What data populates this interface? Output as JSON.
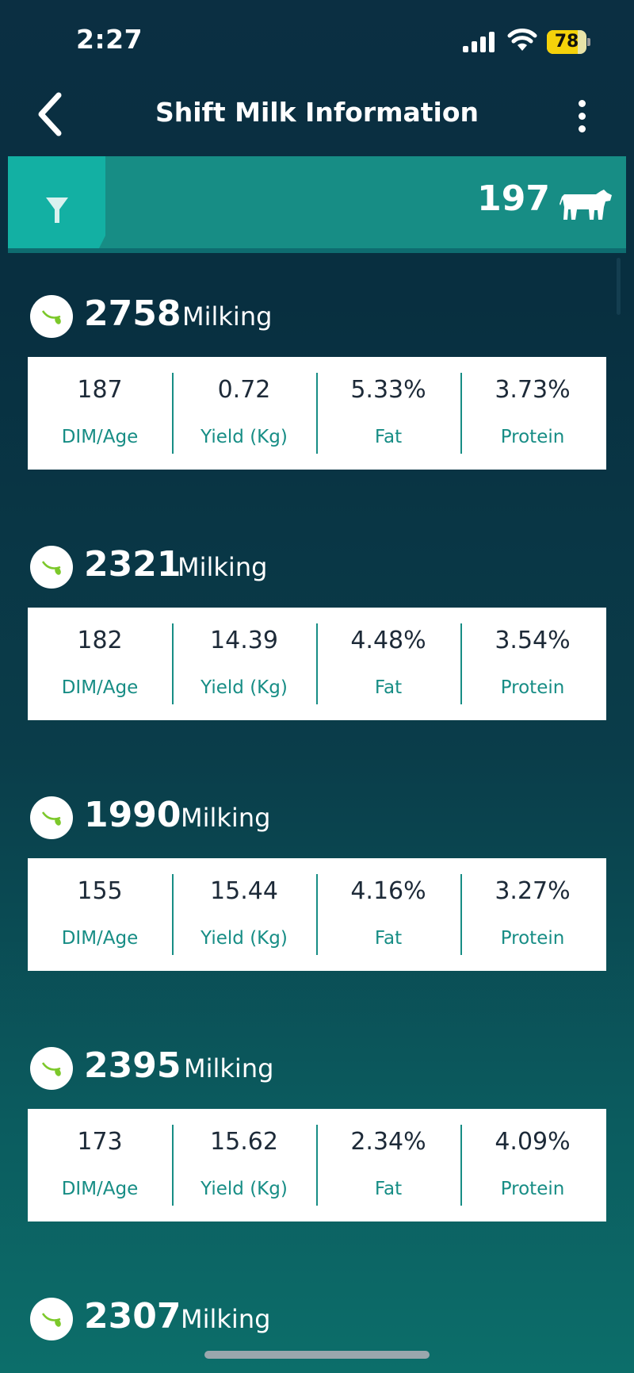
{
  "status_bar": {
    "time": "2:27",
    "battery": "78",
    "battery_level": 0.78
  },
  "nav": {
    "title": "Shift Milk Information"
  },
  "filter_bar": {
    "count": "197"
  },
  "metric_labels": {
    "dim": "DIM/Age",
    "yield": "Yield (Kg)",
    "fat": "Fat",
    "protein": "Protein"
  },
  "animals": [
    {
      "id": "2758",
      "status": "Milking",
      "dim": "187",
      "yield": "0.72",
      "fat": "5.33%",
      "protein": "3.73%"
    },
    {
      "id": "2321",
      "status": "Milking",
      "dim": "182",
      "yield": "14.39",
      "fat": "4.48%",
      "protein": "3.54%"
    },
    {
      "id": "1990",
      "status": "Milking",
      "dim": "155",
      "yield": "15.44",
      "fat": "4.16%",
      "protein": "3.27%"
    },
    {
      "id": "2395",
      "status": "Milking",
      "dim": "173",
      "yield": "15.62",
      "fat": "2.34%",
      "protein": "4.09%"
    },
    {
      "id": "2307",
      "status": "Milking"
    }
  ],
  "colors": {
    "accent": "#178d85",
    "filter_button": "#13b0a3",
    "value_text": "#1d2a38",
    "status_icon": "#7cc82a"
  }
}
